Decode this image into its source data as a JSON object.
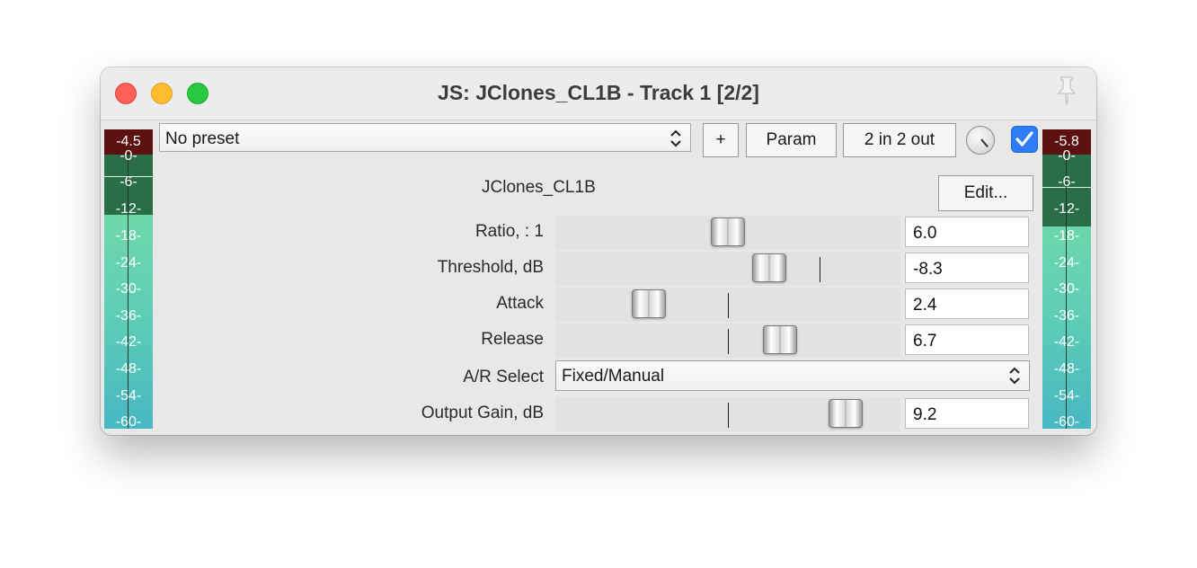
{
  "window": {
    "title": "JS: JClones_CL1B - Track 1 [2/2]"
  },
  "meters": {
    "left_peak": "-4.5",
    "right_peak": "-5.8",
    "scale": [
      "-0-",
      "-6-",
      "-12-",
      "-18-",
      "-24-",
      "-30-",
      "-36-",
      "-42-",
      "-48-",
      "-54-",
      "-60-"
    ]
  },
  "toolbar": {
    "preset_value": "No preset",
    "add_label": "+",
    "param_label": "Param",
    "io_label": "2 in 2 out",
    "enabled": true
  },
  "plugin": {
    "name": "JClones_CL1B",
    "edit_label": "Edit..."
  },
  "params": [
    {
      "label": "Ratio, : 1",
      "value": "6.0",
      "pos": 0.5
    },
    {
      "label": "Threshold, dB",
      "value": "-8.3",
      "pos": 0.62
    },
    {
      "label": "Attack",
      "value": "2.4",
      "pos": 0.27
    },
    {
      "label": "Release",
      "value": "6.7",
      "pos": 0.65
    },
    {
      "label": "Output Gain, dB",
      "value": "9.2",
      "pos": 0.84
    }
  ],
  "ar_select": {
    "label": "A/R Select",
    "value": "Fixed/Manual"
  },
  "colors": {
    "accent": "#2f7df6",
    "meter_peak": "#5c1010"
  }
}
